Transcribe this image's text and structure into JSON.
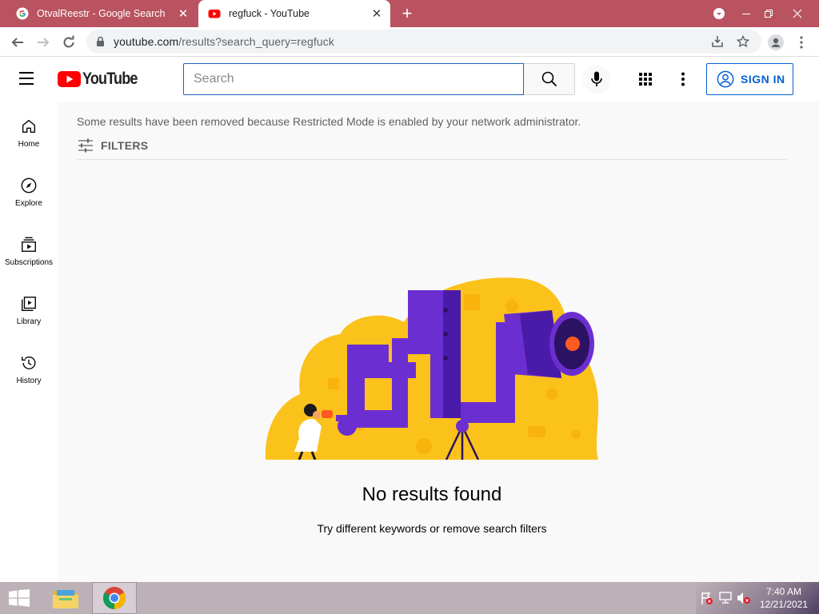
{
  "browser": {
    "tabs": [
      {
        "title": "OtvalReestr - Google Search",
        "favicon": "google-g-icon",
        "active": false
      },
      {
        "title": "regfuck - YouTube",
        "favicon": "youtube-icon",
        "active": true
      }
    ],
    "url_host": "youtube.com",
    "url_path": "/results?search_query=regfuck",
    "colors": {
      "tab_strip": "#b9535f",
      "omnibox": "#f1f3f4"
    }
  },
  "header": {
    "logo_text": "YouTube",
    "search_placeholder": "Search",
    "signin_label": "SIGN IN"
  },
  "rail": {
    "items": [
      {
        "label": "Home",
        "icon": "home-icon"
      },
      {
        "label": "Explore",
        "icon": "compass-icon"
      },
      {
        "label": "Subscriptions",
        "icon": "subscriptions-icon"
      },
      {
        "label": "Library",
        "icon": "library-icon"
      },
      {
        "label": "History",
        "icon": "history-icon"
      }
    ]
  },
  "main": {
    "notice": "Some results have been removed because Restricted Mode is enabled by your network administrator.",
    "filters_label": "FILTERS",
    "no_results_title": "No results found",
    "no_results_hint": "Try different keywords or remove search filters"
  },
  "taskbar": {
    "time": "7:40 AM",
    "date": "12/21/2021",
    "apps": [
      "file-explorer-icon",
      "chrome-icon"
    ]
  },
  "colors": {
    "yt_red": "#ff0000",
    "accent_blue": "#065fd4",
    "illustration_yellow": "#fbc21b",
    "illustration_purple": "#6b2fd1"
  }
}
